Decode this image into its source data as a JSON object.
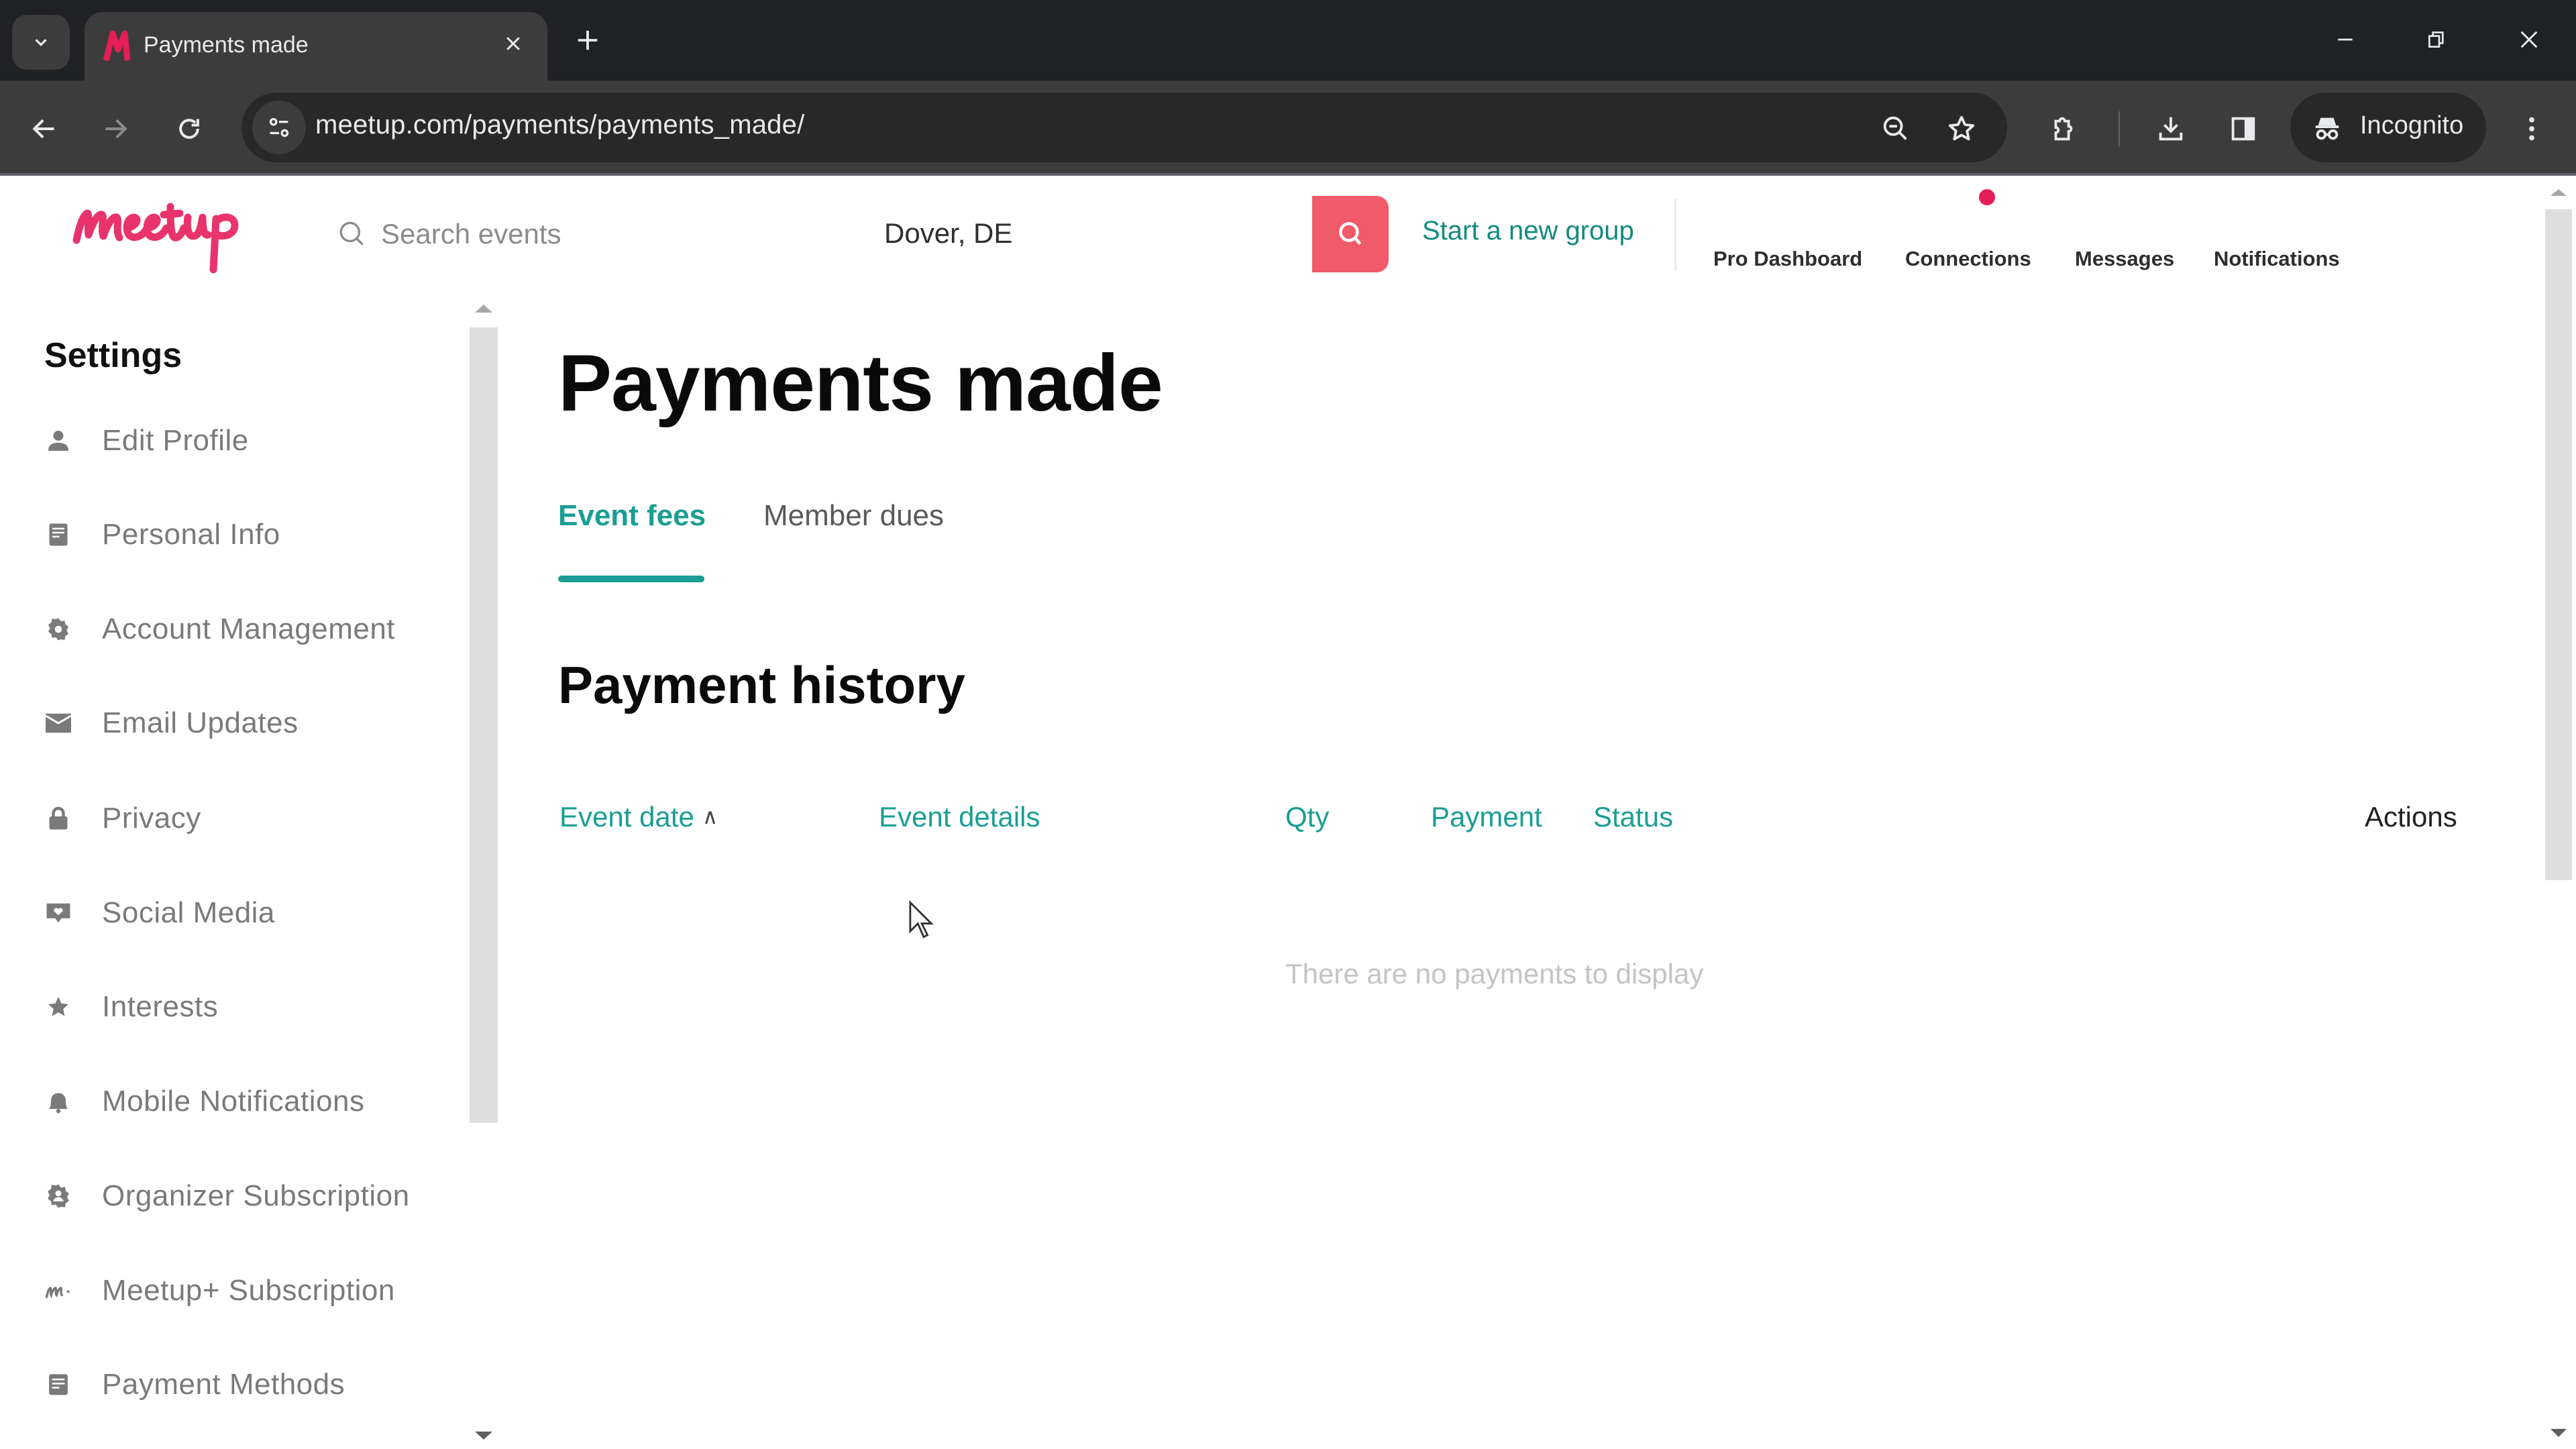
{
  "browser": {
    "tab_title": "Payments made",
    "url": "meetup.com/payments/payments_made/",
    "incognito_label": "Incognito",
    "icons": {
      "tab_search": "chevron-down-icon",
      "tab_close": "close-icon",
      "new_tab": "plus-icon",
      "minimize": "minimize-icon",
      "restore": "restore-icon",
      "close_window": "close-icon",
      "back": "arrow-left-icon",
      "forward": "arrow-right-icon",
      "reload": "reload-icon",
      "site_info": "tune-icon",
      "zoom": "zoom-out-icon",
      "bookmark": "star-icon",
      "extensions": "puzzle-icon",
      "downloads": "download-icon",
      "side_panel": "side-panel-icon",
      "incognito": "incognito-icon",
      "menu": "more-vert-icon"
    }
  },
  "header": {
    "logo_text": "Meetup",
    "search_placeholder": "Search events",
    "location_value": "Dover, DE",
    "start_group_label": "Start a new group",
    "nav_links": [
      "Pro Dashboard",
      "Connections",
      "Messages",
      "Notifications"
    ],
    "brand_color": "#f05a69",
    "accent_color": "#1a9e93"
  },
  "sidebar": {
    "title": "Settings",
    "items": [
      {
        "label": "Edit Profile",
        "icon": "person-icon"
      },
      {
        "label": "Personal Info",
        "icon": "document-icon"
      },
      {
        "label": "Account Management",
        "icon": "gear-icon"
      },
      {
        "label": "Email Updates",
        "icon": "mail-icon"
      },
      {
        "label": "Privacy",
        "icon": "lock-icon"
      },
      {
        "label": "Social Media",
        "icon": "social-heart-icon"
      },
      {
        "label": "Interests",
        "icon": "star-icon"
      },
      {
        "label": "Mobile Notifications",
        "icon": "bell-icon"
      },
      {
        "label": "Organizer Subscription",
        "icon": "organizer-badge-icon"
      },
      {
        "label": "Meetup+ Subscription",
        "icon": "meetup-plus-icon"
      },
      {
        "label": "Payment Methods",
        "icon": "card-icon"
      }
    ]
  },
  "main": {
    "page_title": "Payments made",
    "tabs": [
      {
        "label": "Event fees",
        "active": true
      },
      {
        "label": "Member dues",
        "active": false
      }
    ],
    "section_title": "Payment history",
    "table": {
      "columns": [
        "Event date",
        "Event details",
        "Qty",
        "Payment",
        "Status",
        "Actions"
      ],
      "sort_column": "Event date",
      "sort_direction": "ascending",
      "rows": [],
      "empty_message": "There are no payments to display"
    }
  }
}
